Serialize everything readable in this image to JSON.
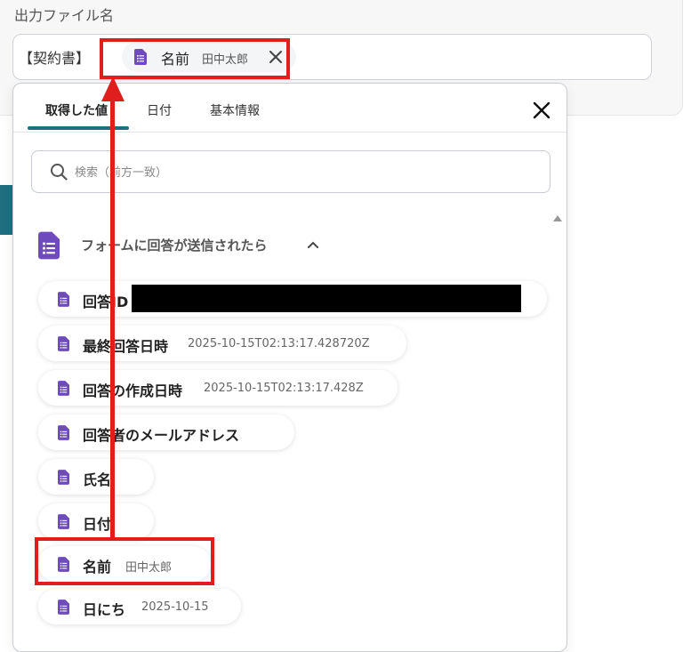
{
  "output_field": {
    "label": "出力ファイル名",
    "prefix": "【契約書】",
    "chip": {
      "name": "名前",
      "value": "田中太郎"
    }
  },
  "dropdown": {
    "tabs": [
      {
        "label": "取得した値",
        "active": true
      },
      {
        "label": "日付",
        "active": false
      },
      {
        "label": "基本情報",
        "active": false
      }
    ],
    "search_placeholder": "検索（前方一致）",
    "group": {
      "label": "フォームに回答が送信されたら",
      "items": [
        {
          "label": "回答ID",
          "value": ""
        },
        {
          "label": "最終回答日時",
          "value": "2025-10-15T02:13:17.428720Z"
        },
        {
          "label": "回答の作成日時",
          "value": "2025-10-15T02:13:17.428Z"
        },
        {
          "label": "回答者のメールアドレス",
          "value": ""
        },
        {
          "label": "氏名",
          "value": ""
        },
        {
          "label": "日付",
          "value": ""
        },
        {
          "label": "名前",
          "value": "田中太郎"
        },
        {
          "label": "日にち",
          "value": "2025-10-15"
        }
      ]
    }
  },
  "colors": {
    "accent": "#1f6f80",
    "doc_icon": "#6e4bbd",
    "highlight": "#e01e1e"
  },
  "icons": {
    "doc": "google-forms-doc-icon",
    "close": "close-icon",
    "search": "search-icon",
    "collapse": "chevron-up-icon"
  }
}
